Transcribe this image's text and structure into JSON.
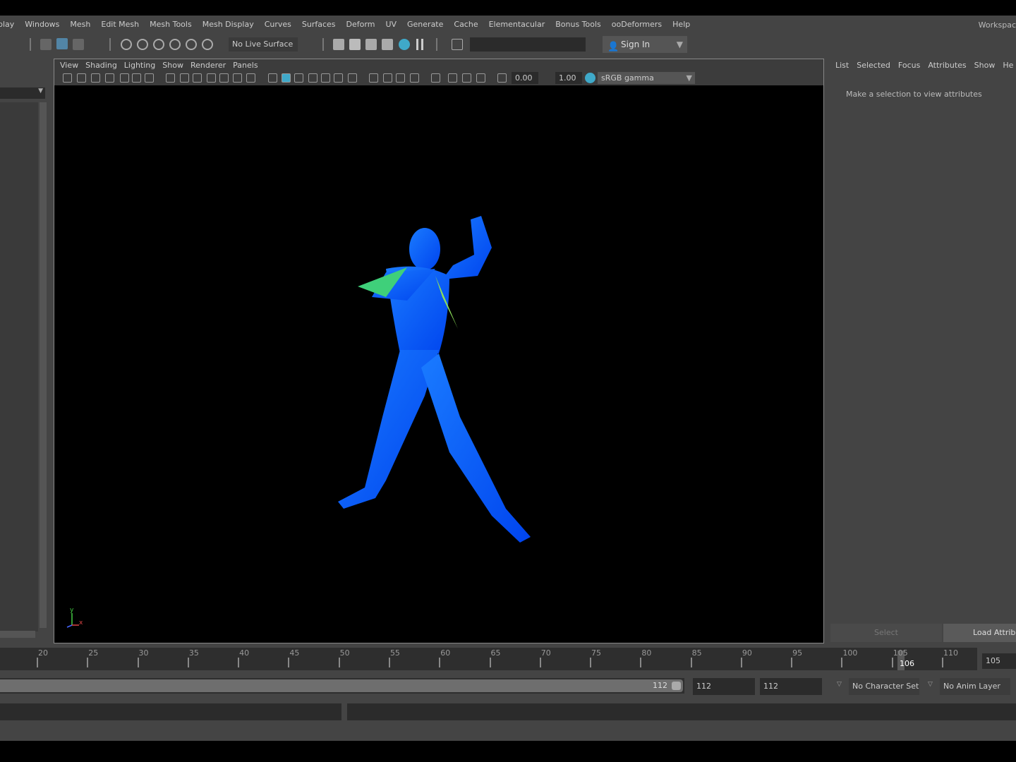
{
  "menubar": {
    "items": [
      "play",
      "Windows",
      "Mesh",
      "Edit Mesh",
      "Mesh Tools",
      "Mesh Display",
      "Curves",
      "Surfaces",
      "Deform",
      "UV",
      "Generate",
      "Cache",
      "Elementacular",
      "Bonus Tools",
      "ooDeformers",
      "Help"
    ],
    "workspace": "Workspac"
  },
  "toolbar": {
    "live_surface": "No Live Surface",
    "sign_in": "Sign In",
    "search_value": ""
  },
  "viewport": {
    "menu": [
      "View",
      "Shading",
      "Lighting",
      "Show",
      "Renderer",
      "Panels"
    ],
    "exposure": "0.00",
    "gamma": "1.00",
    "color_space": "sRGB gamma",
    "axis_y": "y",
    "axis_x": "x",
    "accent": "#3fa9c9",
    "mesh_color": "#0a6cff"
  },
  "attribute_editor": {
    "tabs": [
      "List",
      "Selected",
      "Focus",
      "Attributes",
      "Show",
      "He"
    ],
    "message": "Make a selection to view attributes",
    "select_button": "Select",
    "load_button": "Load Attribu"
  },
  "timeline": {
    "ticks": [
      "20",
      "25",
      "30",
      "35",
      "40",
      "45",
      "50",
      "55",
      "60",
      "65",
      "70",
      "75",
      "80",
      "85",
      "90",
      "95",
      "100",
      "105",
      "110"
    ],
    "current_frame": "106",
    "current_field": "105"
  },
  "range": {
    "slider_end": "112",
    "end_field": "112",
    "max_field": "112",
    "character_set": "No Character Set",
    "anim_layer": "No Anim Layer"
  }
}
